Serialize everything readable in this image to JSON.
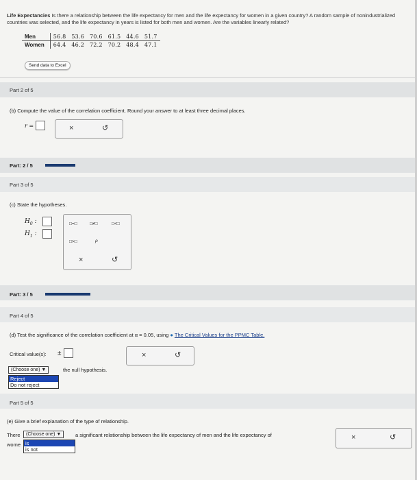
{
  "intro": {
    "title": "Life Expectancies",
    "text": "Is there a relationship between the life expectancy for men and the life expectancy for women in a given country? A random sample of nonindustrialized countries was selected, and the life expectancy in years is listed for both men and women. Are the variables linearly related?"
  },
  "table": {
    "rows": [
      {
        "label": "Men",
        "values": [
          "56.8",
          "53.6",
          "70.6",
          "61.5",
          "44.6",
          "51.7"
        ]
      },
      {
        "label": "Women",
        "values": [
          "64.4",
          "46.2",
          "72.2",
          "70.2",
          "48.4",
          "47.1"
        ]
      }
    ]
  },
  "excel_button": "Send data to Excel",
  "part2": {
    "label": "Part 2 of 5",
    "question": "(b) Compute the value of the correlation coefficient. Round your answer to at least three decimal places.",
    "r_label": "r =",
    "progress_label": "Part: 2 / 5"
  },
  "part3": {
    "label": "Part 3 of 5",
    "question": "(c) State the hypotheses.",
    "h0": "H",
    "h0_sub": "0",
    "h1": "H",
    "h1_sub": "1",
    "colon": ":",
    "symbols": [
      "□=□",
      "□≠□",
      "□<□",
      "□>□",
      "ρ"
    ],
    "progress_label": "Part: 3 / 5"
  },
  "part4": {
    "label": "Part 4 of 5",
    "question_pre": "(d) Test the significance of the correlation coefficient at α = 0.05, using",
    "link": "The Critical Values for the PPMC Table.",
    "critical_label": "Critical value(s):",
    "pm": "±",
    "dropdown": "(Choose one)",
    "after_dropdown": "the null hypothesis.",
    "options": [
      "Reject",
      "Do not reject"
    ]
  },
  "part5": {
    "label": "Part 5 of 5",
    "question": "(e) Give a brief explanation of the type of relationship.",
    "pre": "There",
    "dropdown": "(Choose one)",
    "post": "a significant relationship between the life expectancy of men and the life expectancy of",
    "wrap": "women.",
    "wrap_hidden_part": "wome",
    "options": [
      "is",
      "is not"
    ]
  },
  "icons": {
    "clear": "×",
    "undo": "↺"
  },
  "colors": {
    "progress": "#1a3a70",
    "banner": "#e0e2e3",
    "selection": "#1c46b3"
  }
}
